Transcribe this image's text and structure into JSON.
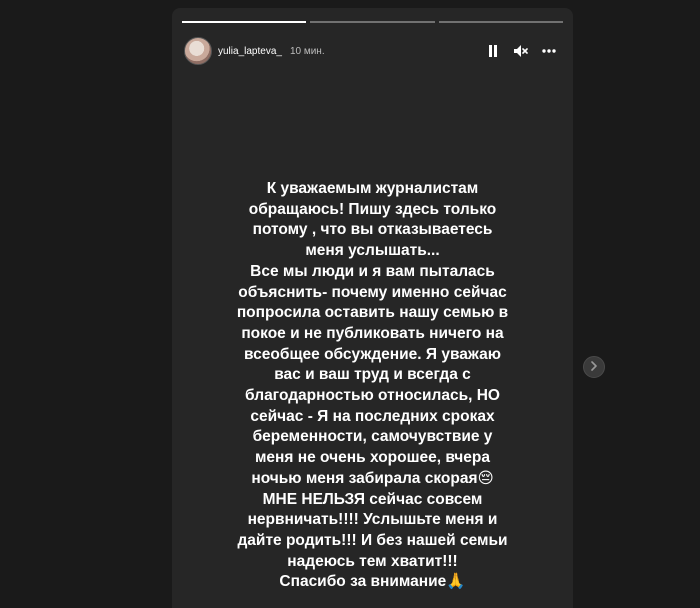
{
  "story": {
    "progress": [
      1,
      0,
      0
    ],
    "user": {
      "username": "yulia_lapteva_",
      "time": "10 мин."
    },
    "controls": {
      "pause_icon": "pause-icon",
      "mute_icon": "mute-icon",
      "more_icon": "more-icon"
    },
    "text": "К уважаемым журналистам\nобращаюсь! Пишу здесь только\nпотому , что вы отказываетесь\nменя услышать...\nВсе мы люди и я вам пыталась\nобъяснить- почему именно сейчас\nпопросила оставить нашу семью в\nпокое и не публиковать ничего на\nвсеобщее обсуждение. Я уважаю\nвас и ваш труд и всегда с\nблагодарностью относилась, НО\nсейчас -  Я на последних сроках\nбеременности, самочувствие у\nменя не очень хорошее, вчера\nночью меня забирала скорая😔\nМНЕ НЕЛЬЗЯ сейчас совсем\nнервничать!!!! Услышьте меня и\nдайте родить!!! И без нашей семьи\nнадеюсь тем хватит!!!\nСпасибо за внимание🙏"
  },
  "nav": {
    "next_icon": "chevron-right-icon"
  },
  "colors": {
    "background": "#1a1a1a",
    "story_background": "#262626",
    "text": "#ffffff"
  }
}
